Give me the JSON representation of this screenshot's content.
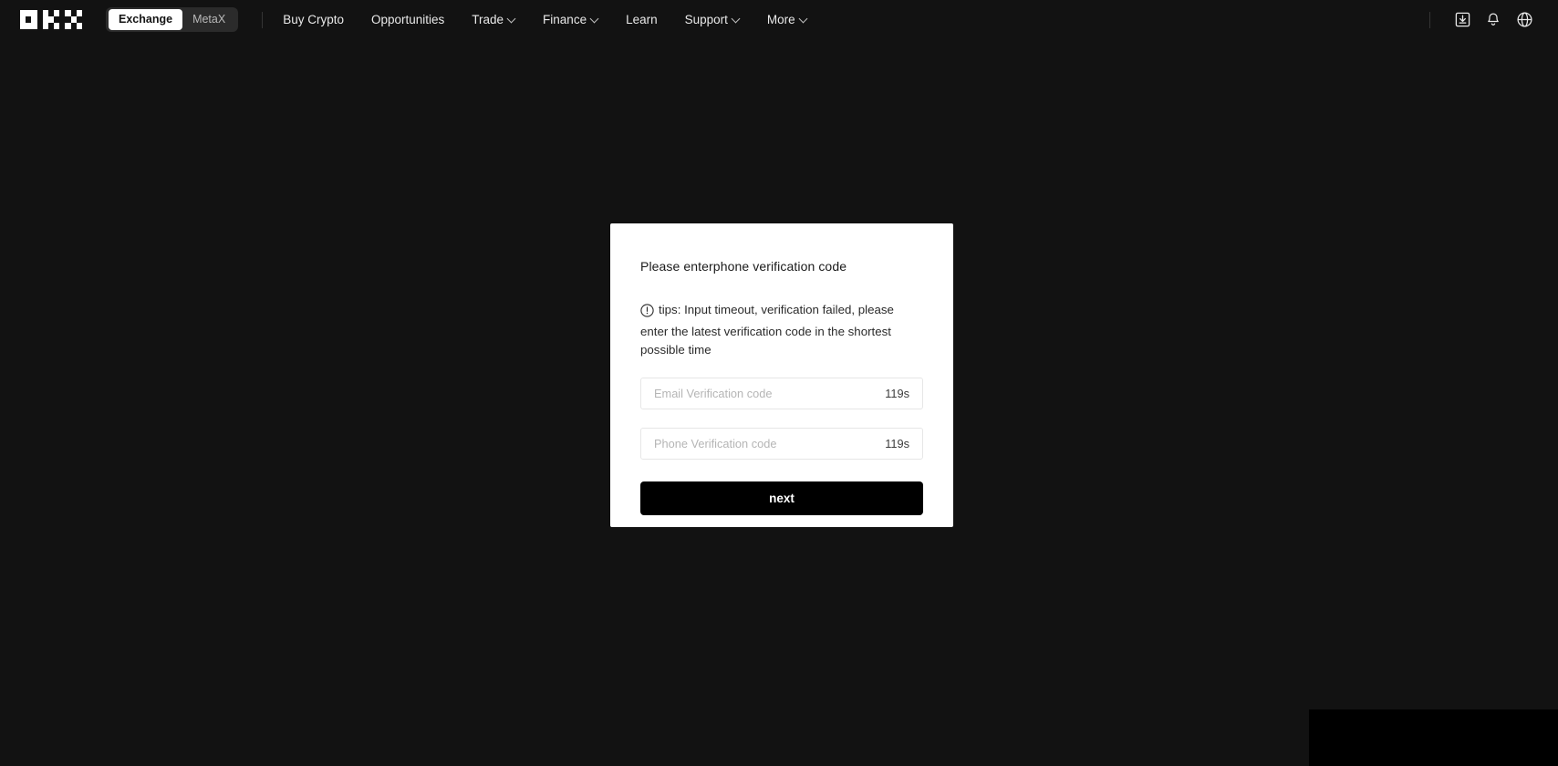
{
  "brand": {
    "logo_name": "okx-logo",
    "logo_alt": "OKX"
  },
  "navbar": {
    "toggle": {
      "exchange_label": "Exchange",
      "metax_label": "MetaX",
      "active": "Exchange"
    },
    "links": [
      {
        "label": "Buy Crypto",
        "has_caret": false
      },
      {
        "label": "Opportunities",
        "has_caret": false
      },
      {
        "label": "Trade",
        "has_caret": true
      },
      {
        "label": "Finance",
        "has_caret": true
      },
      {
        "label": "Learn",
        "has_caret": false
      },
      {
        "label": "Support",
        "has_caret": true
      },
      {
        "label": "More",
        "has_caret": true
      }
    ],
    "icons": [
      {
        "name": "download-icon"
      },
      {
        "name": "bell-icon"
      },
      {
        "name": "globe-icon"
      }
    ]
  },
  "modal": {
    "title": "Please enterphone verification code",
    "tips_icon": "exclamation-circle-icon",
    "tips_text": "tips: Input timeout, verification failed, please enter the latest verification code in the shortest possible time",
    "fields": [
      {
        "name": "email-verification-code",
        "placeholder": "Email Verification code",
        "value": "",
        "timer": "119s"
      },
      {
        "name": "phone-verification-code",
        "placeholder": "Phone Verification code",
        "value": "",
        "timer": "119s"
      }
    ],
    "submit_label": "next"
  },
  "colors": {
    "page_background": "#121212",
    "navbar_background": "#121212",
    "card_background": "#ffffff",
    "button_background": "#000000",
    "accent_text": "#ffffff"
  }
}
